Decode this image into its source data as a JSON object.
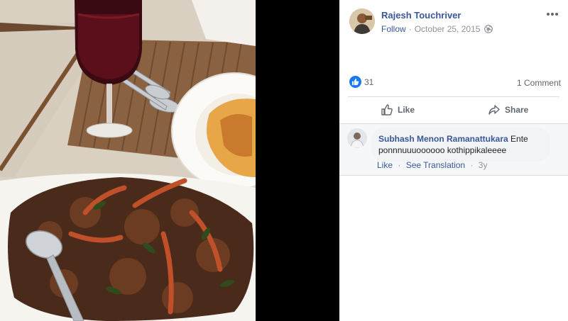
{
  "post": {
    "author": "Rajesh Touchriver",
    "follow_label": "Follow",
    "separator": "·",
    "date": "October 25, 2015",
    "privacy_icon": "globe-icon",
    "more_icon": "more-options-icon"
  },
  "stats": {
    "reaction_icon": "like-reaction-icon",
    "reaction_count": "31",
    "comment_count_label": "1 Comment"
  },
  "actions": {
    "like_label": "Like",
    "share_label": "Share"
  },
  "comment": {
    "author": "Subhash Menon Ramanattukara",
    "text": " Ente ponnnuuuoooooo kothippikaleeee",
    "like_label": "Like",
    "separator": "·",
    "translate_label": "See Translation",
    "age": "3y"
  },
  "colors": {
    "link": "#385898",
    "muted": "#90949c",
    "brand": "#1877f2",
    "comment_bg": "#f2f3f5"
  }
}
